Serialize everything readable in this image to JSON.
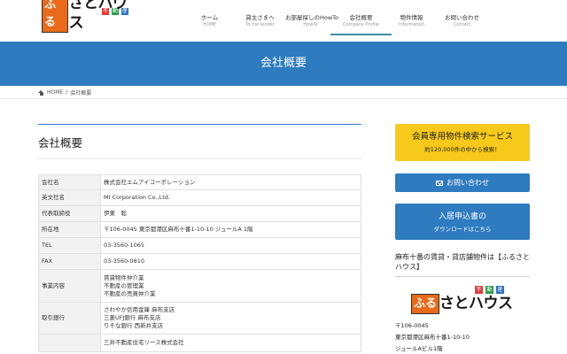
{
  "logo": {
    "box_text": "ふる",
    "main_text": "さとハウス",
    "tags": [
      {
        "text": "不",
        "color": "#e23b3b"
      },
      {
        "text": "動",
        "color": "#2e9a4a"
      },
      {
        "text": "産",
        "color": "#2e6fc0"
      }
    ]
  },
  "nav": [
    {
      "jp": "ホーム",
      "en": "HOME",
      "active": false
    },
    {
      "jp": "貸主さまへ",
      "en": "To the lender",
      "active": false
    },
    {
      "jp": "お部屋探しのHowTo",
      "en": "HowTo",
      "active": false
    },
    {
      "jp": "会社概要",
      "en": "Company Profile",
      "active": true
    },
    {
      "jp": "物件情報",
      "en": "Information",
      "active": false
    },
    {
      "jp": "お問い合わせ",
      "en": "Contact",
      "active": false
    }
  ],
  "banner": {
    "title": "会社概要"
  },
  "breadcrumb": {
    "home": "HOME",
    "separator": "/",
    "current": "会社概要"
  },
  "main": {
    "title": "会社概要",
    "rows": [
      {
        "label": "会社名",
        "values": [
          "株式会社エムアイコーポレーション"
        ]
      },
      {
        "label": "英文社名",
        "values": [
          "MI Corporation Co.,Ltd."
        ]
      },
      {
        "label": "代表取締役",
        "values": [
          "伊東　聡"
        ]
      },
      {
        "label": "所在地",
        "values": [
          "〒106-0045 東京都港区麻布十番1-10-10 ジュールA 1階"
        ]
      },
      {
        "label": "TEL",
        "values": [
          "03-3560-1065"
        ]
      },
      {
        "label": "FAX",
        "values": [
          "03-3560-0810"
        ]
      },
      {
        "label": "事業内容",
        "values": [
          "賃貸物件仲介業",
          "不動産の管理業",
          "不動産の売買仲介業"
        ]
      },
      {
        "label": "取引銀行",
        "values": [
          "さわやか信用金庫 麻布支店",
          "三菱UFJ銀行 麻布支店",
          "りそな銀行 西新井支店"
        ]
      },
      {
        "label": "",
        "values": [
          "三井不動産住宅リース株式会社"
        ]
      }
    ]
  },
  "sidebar": {
    "member_search": {
      "line1": "会員専用物件検索サービス",
      "line2": "約120,000件の中から検索！"
    },
    "contact_label": "お問い合わせ",
    "application": {
      "line1": "入居申込書の",
      "line2": "ダウンロードはこちら"
    },
    "heading": "麻布十番の賃貸・貸店舗物件は【ふるさとハウス】",
    "address": [
      "〒106-0045",
      "東京都港区麻布十番1-10-10",
      "ジュールAビル1階"
    ]
  },
  "colors": {
    "brand_blue": "#2e7bbf",
    "accent_yellow": "#f6c91a",
    "logo_orange": "#e86a1a",
    "active_nav": "#3f8f9f"
  }
}
